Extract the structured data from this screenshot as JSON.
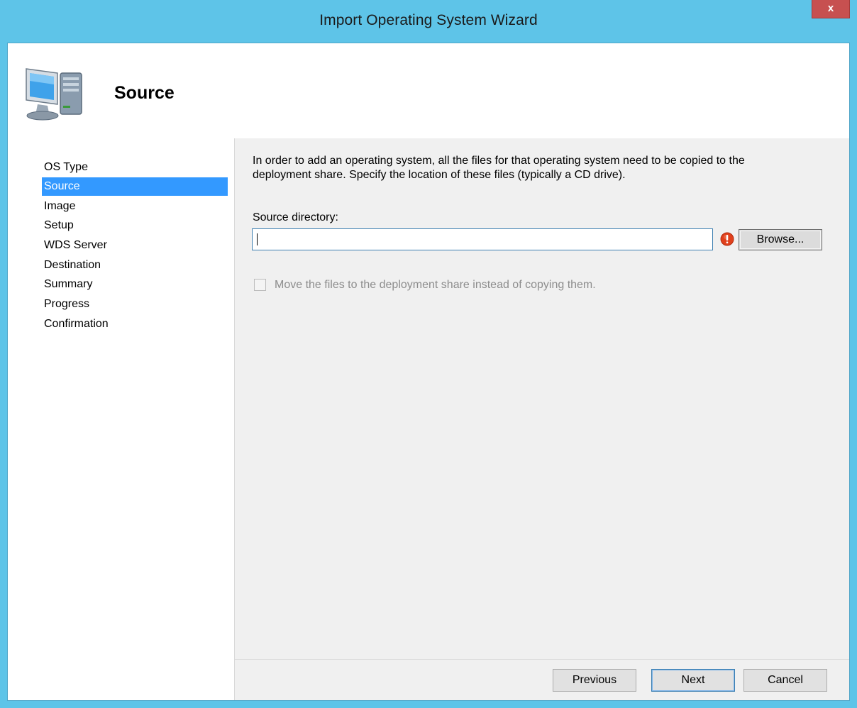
{
  "window": {
    "title": "Import Operating System Wizard",
    "close_label": "x",
    "accent_color": "#5ec4e8"
  },
  "header": {
    "title": "Source",
    "icon": "computer-icon"
  },
  "nav": {
    "items": [
      {
        "label": "OS Type",
        "selected": false
      },
      {
        "label": "Source",
        "selected": true
      },
      {
        "label": "Image",
        "selected": false
      },
      {
        "label": "Setup",
        "selected": false
      },
      {
        "label": "WDS Server",
        "selected": false
      },
      {
        "label": "Destination",
        "selected": false
      },
      {
        "label": "Summary",
        "selected": false
      },
      {
        "label": "Progress",
        "selected": false
      },
      {
        "label": "Confirmation",
        "selected": false
      }
    ],
    "selected_color": "#3399ff"
  },
  "content": {
    "description_line1": "In order to add an operating system, all the files for that operating system need to be copied to the",
    "description_line2": "deployment share.  Specify the location of these files (typically a CD drive).",
    "source_label": "Source directory:",
    "source_value": "",
    "error_icon": "error-icon",
    "browse_label": "Browse...",
    "move_checkbox_label": "Move the files to the deployment share instead of copying them.",
    "move_checkbox_checked": false,
    "move_checkbox_enabled": false
  },
  "footer": {
    "previous_label": "Previous",
    "next_label": "Next",
    "cancel_label": "Cancel"
  }
}
